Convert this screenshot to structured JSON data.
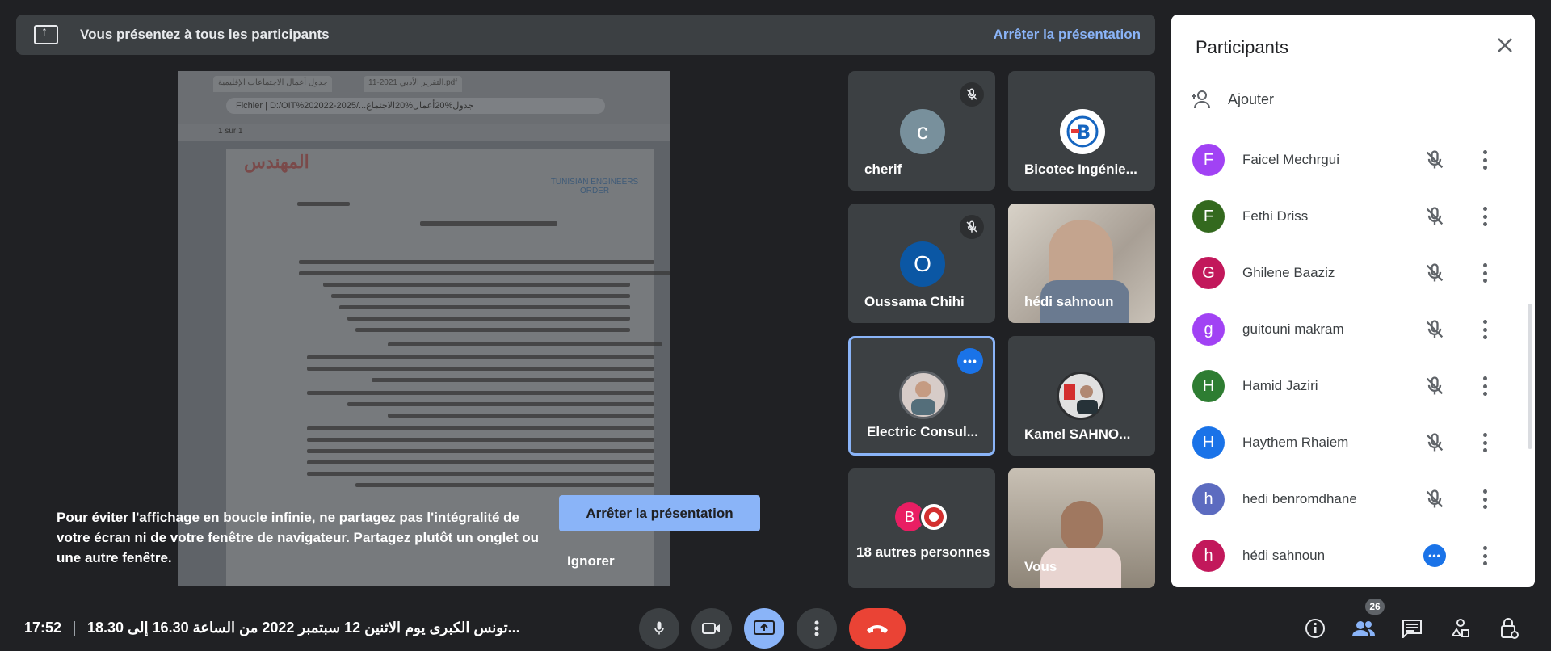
{
  "banner": {
    "message": "Vous présentez à tous les participants",
    "stop_label": "Arrêter la présentation"
  },
  "shared_screen": {
    "tab1": "جدول أعمال الاجتماعات الإقليمية",
    "tab2": "التقرير الأدبي 2021-11.pdf",
    "address": "Fichier  |  D:/OIT%202022-2025/...جدول%20أعمال%20الاجتماع",
    "page_info": "1  sur 1",
    "logo_left": "المهندس",
    "logo_right": "TUNISIAN ENGINEERS ORDER"
  },
  "overlay": {
    "message": "Pour éviter l'affichage en boucle infinie, ne partagez pas l'intégralité de votre écran ni de votre fenêtre de navigateur. Partagez plutôt un onglet ou une autre fenêtre.",
    "stop_label": "Arrêter la présentation",
    "ignore_label": "Ignorer"
  },
  "tiles": [
    {
      "name": "cherif",
      "initial": "c",
      "color": "#78909c",
      "muted": true
    },
    {
      "name": "Bicotec Ingénie...",
      "initial": "B",
      "color": "#ffffff",
      "muted": false
    },
    {
      "name": "Oussama Chihi",
      "initial": "O",
      "color": "#0b57a4",
      "muted": true
    },
    {
      "name": "hédi sahnoun",
      "initial": "",
      "color": "#b0a8a0",
      "muted": false
    },
    {
      "name": "Electric Consul...",
      "initial": "",
      "color": "#8a8f95",
      "muted": false
    },
    {
      "name": "Kamel SAHNO...",
      "initial": "",
      "color": "#555",
      "muted": false
    },
    {
      "name": "18 autres personnes",
      "initial": "B",
      "color": "#e91e63",
      "muted": false
    },
    {
      "name": "Vous",
      "initial": "",
      "color": "#9a8f80",
      "muted": false
    }
  ],
  "panel": {
    "title": "Participants",
    "add_label": "Ajouter",
    "participants": [
      {
        "name": "Faicel Mechrgui",
        "initial": "F",
        "color": "#a142f4",
        "state": "muted"
      },
      {
        "name": "Fethi Driss",
        "initial": "F",
        "color": "#33691e",
        "state": "muted"
      },
      {
        "name": "Ghilene Baaziz",
        "initial": "G",
        "color": "#c2185b",
        "state": "muted"
      },
      {
        "name": "guitouni makram",
        "initial": "g",
        "color": "#a142f4",
        "state": "muted"
      },
      {
        "name": "Hamid Jaziri",
        "initial": "H",
        "color": "#2e7d32",
        "state": "muted"
      },
      {
        "name": "Haythem Rhaiem",
        "initial": "H",
        "color": "#1a73e8",
        "state": "muted"
      },
      {
        "name": "hedi benromdhane",
        "initial": "h",
        "color": "#5c6bc0",
        "state": "muted"
      },
      {
        "name": "hédi sahnoun",
        "initial": "h",
        "color": "#c2185b",
        "state": "speaking"
      }
    ]
  },
  "bottom": {
    "time": "17:52",
    "meeting_title": "تونس الكبرى يوم الاثنين 12 سبتمبر 2022 من الساعة 16.30 إلى 18.30...",
    "participants_count": "26"
  }
}
